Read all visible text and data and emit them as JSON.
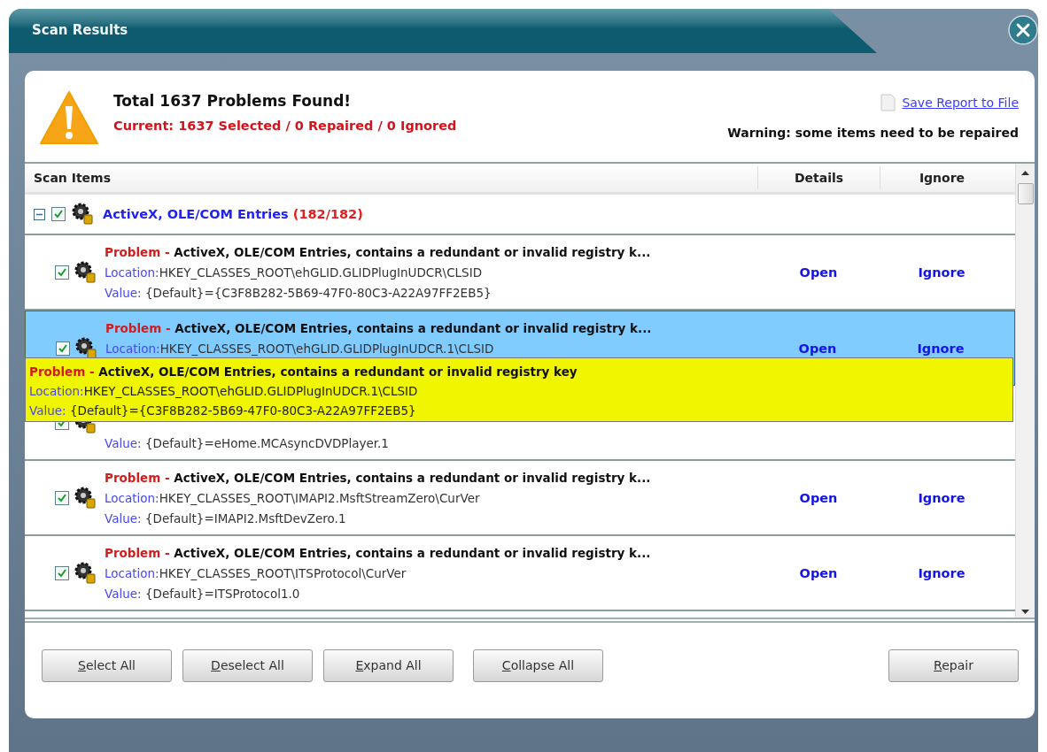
{
  "window": {
    "title": "Scan Results"
  },
  "summary": {
    "title": "Total 1637 Problems Found!",
    "status": "Current: 1637 Selected / 0 Repaired / 0 Ignored",
    "save_link": "Save Report to File",
    "warning": "Warning: some items need to be repaired"
  },
  "table": {
    "columns": [
      "Scan Items",
      "Details",
      "Ignore"
    ],
    "group": {
      "label": "ActiveX, OLE/COM Entries",
      "count": "(182/182)",
      "expanded": true,
      "checked": true
    },
    "rows": [
      {
        "selected": false,
        "checked": true,
        "problem_label": "Problem -",
        "problem": "ActiveX, OLE/COM Entries, contains a redundant or invalid registry k...",
        "location_label": "Location:",
        "location": "HKEY_CLASSES_ROOT\\ehGLID.GLIDPlugInUDCR\\CLSID",
        "value_label": "Value:",
        "value": "{Default}={C3F8B282-5B69-47F0-80C3-A22A97FF2EB5}",
        "details": "Open",
        "ignore": "Ignore"
      },
      {
        "selected": true,
        "checked": true,
        "problem_label": "Problem -",
        "problem": "ActiveX, OLE/COM Entries, contains a redundant or invalid registry k...",
        "location_label": "Location:",
        "location": "HKEY_CLASSES_ROOT\\ehGLID.GLIDPlugInUDCR.1\\CLSID",
        "details": "Open",
        "ignore": "Ignore"
      },
      {
        "selected": false,
        "checked": true,
        "value_label": "Value:",
        "value": "{Default}=eHome.MCAsyncDVDPlayer.1"
      },
      {
        "selected": false,
        "checked": true,
        "problem_label": "Problem -",
        "problem": "ActiveX, OLE/COM Entries, contains a redundant or invalid registry k...",
        "location_label": "Location:",
        "location": "HKEY_CLASSES_ROOT\\IMAPI2.MsftStreamZero\\CurVer",
        "value_label": "Value:",
        "value": "{Default}=IMAPI2.MsftDevZero.1",
        "details": "Open",
        "ignore": "Ignore"
      },
      {
        "selected": false,
        "checked": true,
        "problem_label": "Problem -",
        "problem": "ActiveX, OLE/COM Entries, contains a redundant or invalid registry k...",
        "location_label": "Location:",
        "location": "HKEY_CLASSES_ROOT\\ITSProtocol\\CurVer",
        "value_label": "Value:",
        "value": "{Default}=ITSProtocol1.0",
        "details": "Open",
        "ignore": "Ignore"
      }
    ]
  },
  "tooltip": {
    "problem_label": "Problem -",
    "problem": "ActiveX, OLE/COM Entries, contains a redundant or invalid registry key",
    "location_label": "Location:",
    "location": "HKEY_CLASSES_ROOT\\ehGLID.GLIDPlugInUDCR.1\\CLSID",
    "value_label": "Value:",
    "value": "{Default}={C3F8B282-5B69-47F0-80C3-A22A97FF2EB5}"
  },
  "buttons": [
    {
      "accel": "S",
      "rest": "elect All"
    },
    {
      "accel": "D",
      "rest": "eselect All"
    },
    {
      "accel": "E",
      "rest": "xpand All"
    },
    {
      "accel": "C",
      "rest": "ollapse All"
    },
    {
      "accel": "R",
      "rest": "epair"
    }
  ]
}
